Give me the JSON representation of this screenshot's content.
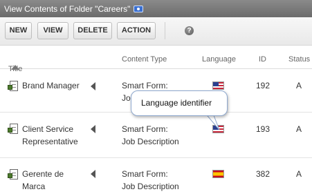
{
  "window": {
    "title": "View Contents of Folder \"Careers\""
  },
  "toolbar": {
    "new": "NEW",
    "view": "VIEW",
    "delete": "DELETE",
    "action": "ACTION",
    "help": "?"
  },
  "columns": {
    "title": "Title",
    "content_type": "Content Type",
    "language": "Language",
    "id": "ID",
    "status": "Status"
  },
  "rows": [
    {
      "title_l1": "Brand Manager",
      "title_l2": "",
      "type_l1": "Smart Form:",
      "type_l2": "Job Description",
      "language": "us-flag",
      "id": "192",
      "status": "A"
    },
    {
      "title_l1": "Client Service",
      "title_l2": "Representative",
      "type_l1": "Smart Form:",
      "type_l2": "Job Description",
      "language": "us-flag",
      "id": "193",
      "status": "A"
    },
    {
      "title_l1": "Gerente de",
      "title_l2": "Marca",
      "type_l1": "Smart Form:",
      "type_l2": "Job Description",
      "language": "es-flag",
      "id": "382",
      "status": "A"
    }
  ],
  "tooltip": {
    "text": "Language identifier"
  }
}
